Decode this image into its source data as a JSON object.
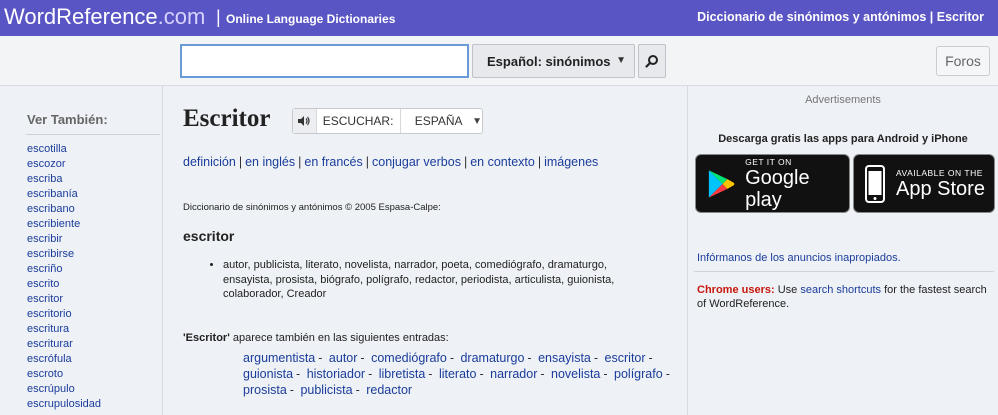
{
  "header": {
    "brand_main": "WordReference",
    "brand_com": ".com",
    "brand_sep": "|",
    "tagline": "Online Language Dictionaries",
    "right_title": "Diccionario de sinónimos y antónimos | Escritor",
    "bar_color": "#5a55c4"
  },
  "search": {
    "value": "",
    "placeholder": "",
    "dictionary_selected": "Español: sinónimos",
    "search_icon": "magnifier-icon",
    "foros_label": "Foros"
  },
  "sidebar": {
    "title": "Ver También:",
    "items": [
      "escotilla",
      "escozor",
      "escriba",
      "escribanía",
      "escribano",
      "escribiente",
      "escribir",
      "escribirse",
      "escriño",
      "escrito",
      "escritor",
      "escritorio",
      "escritura",
      "escriturar",
      "escrófula",
      "escroto",
      "escrúpulo",
      "escrupulosidad"
    ]
  },
  "main": {
    "word": "Escritor",
    "listen_label": "ESCUCHAR:",
    "accent_selected": "ESPAÑA",
    "speaker_icon": "speaker-icon",
    "links": [
      "definición",
      "en inglés",
      "en francés",
      "conjugar verbos",
      "en contexto",
      "imágenes"
    ],
    "credit": "Diccionario de sinónimos y antónimos © 2005 Espasa-Calpe:",
    "headword": "escritor",
    "synonyms_line1": "autor, publicista, literato, novelista, narrador, poeta, comediógrafo, dramaturgo,",
    "synonyms_line2": "ensayista, prosista, biógrafo, polígrafo, redactor, periodista, articulista, guionista,",
    "synonyms_line3": "colaborador, Creador",
    "also_word": "'Escritor'",
    "also_text": " aparece también en las siguientes entradas:",
    "entries": [
      "argumentista",
      "autor",
      "comediógrafo",
      "dramaturgo",
      "ensayista",
      "escritor",
      "guionista",
      "historiador",
      "libretista",
      "literato",
      "narrador",
      "novelista",
      "polígrafo",
      "prosista",
      "publicista",
      "redactor"
    ]
  },
  "right": {
    "ads_label": "Advertisements",
    "app_promo": "Descarga gratis las apps para Android y iPhone",
    "google_small": "GET IT ON",
    "google_big": "Google play",
    "apple_small": "AVAILABLE ON THE",
    "apple_big": "App Store",
    "report_link": "Infórmanos de los anuncios inapropiados.",
    "chrome_label": "Chrome users:",
    "chrome_pre": " Use ",
    "chrome_link": "search shortcuts",
    "chrome_post": " for the fastest search of WordReference."
  }
}
